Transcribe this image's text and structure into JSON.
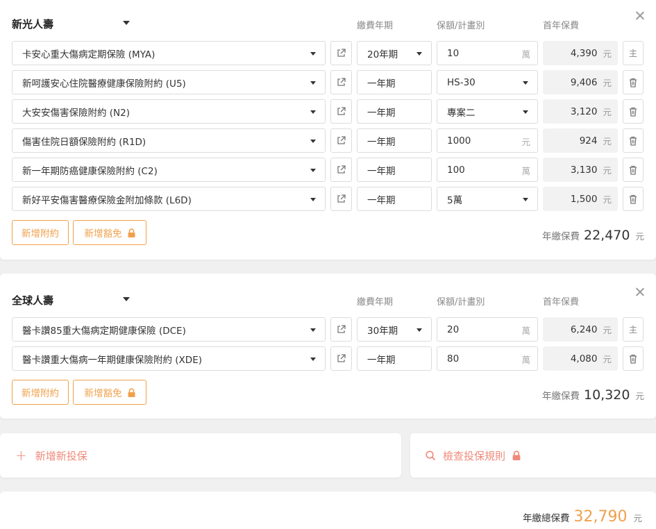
{
  "groups": [
    {
      "company": "新光人壽",
      "headers": {
        "term": "繳費年期",
        "amount": "保額/計畫別",
        "premium": "首年保費"
      },
      "rows": [
        {
          "plan": "卡安心重大傷病定期保險 (MYA)",
          "term": "20年期",
          "amount": "10",
          "unit": "萬",
          "premium": "4,390",
          "premium_unit": "元",
          "action": "主"
        },
        {
          "plan": "新呵護安心住院醫療健康保險附約 (U5)",
          "term": "一年期",
          "amount": "HS-30",
          "unit": "",
          "premium": "9,406",
          "premium_unit": "元",
          "action": "trash-icon"
        },
        {
          "plan": "大安安傷害保險附約 (N2)",
          "term": "一年期",
          "amount": "專案二",
          "unit": "",
          "premium": "3,120",
          "premium_unit": "元",
          "action": "trash-icon"
        },
        {
          "plan": "傷害住院日額保險附約 (R1D)",
          "term": "一年期",
          "amount": "1000",
          "unit": "元",
          "premium": "924",
          "premium_unit": "元",
          "action": "trash-icon"
        },
        {
          "plan": "新一年期防癌健康保險附約 (C2)",
          "term": "一年期",
          "amount": "100",
          "unit": "萬",
          "premium": "3,130",
          "premium_unit": "元",
          "action": "trash-icon"
        },
        {
          "plan": "新好平安傷害醫療保險金附加條款 (L6D)",
          "term": "一年期",
          "amount": "5萬",
          "unit": "",
          "premium": "1,500",
          "premium_unit": "元",
          "action": "trash-icon"
        }
      ],
      "add_rider": "新增附約",
      "add_waiver": "新增豁免",
      "annual_label": "年繳保費",
      "annual_value": "22,470",
      "annual_unit": "元"
    },
    {
      "company": "全球人壽",
      "headers": {
        "term": "繳費年期",
        "amount": "保額/計畫別",
        "premium": "首年保費"
      },
      "rows": [
        {
          "plan": "醫卡讚85重大傷病定期健康保險 (DCE)",
          "term": "30年期",
          "amount": "20",
          "unit": "萬",
          "premium": "6,240",
          "premium_unit": "元",
          "action": "主"
        },
        {
          "plan": "醫卡讚重大傷病一年期健康保險附約 (XDE)",
          "term": "一年期",
          "amount": "80",
          "unit": "萬",
          "premium": "4,080",
          "premium_unit": "元",
          "action": "trash-icon"
        }
      ],
      "add_rider": "新增附約",
      "add_waiver": "新增豁免",
      "annual_label": "年繳保費",
      "annual_value": "10,320",
      "annual_unit": "元"
    }
  ],
  "add_insurance": "新增新投保",
  "check_rules": "檢查投保規則",
  "total": {
    "label": "年繳總保費",
    "value": "32,790",
    "unit": "元"
  },
  "colors": {
    "accent": "#f0a04b",
    "coral": "#ef8a7a"
  }
}
